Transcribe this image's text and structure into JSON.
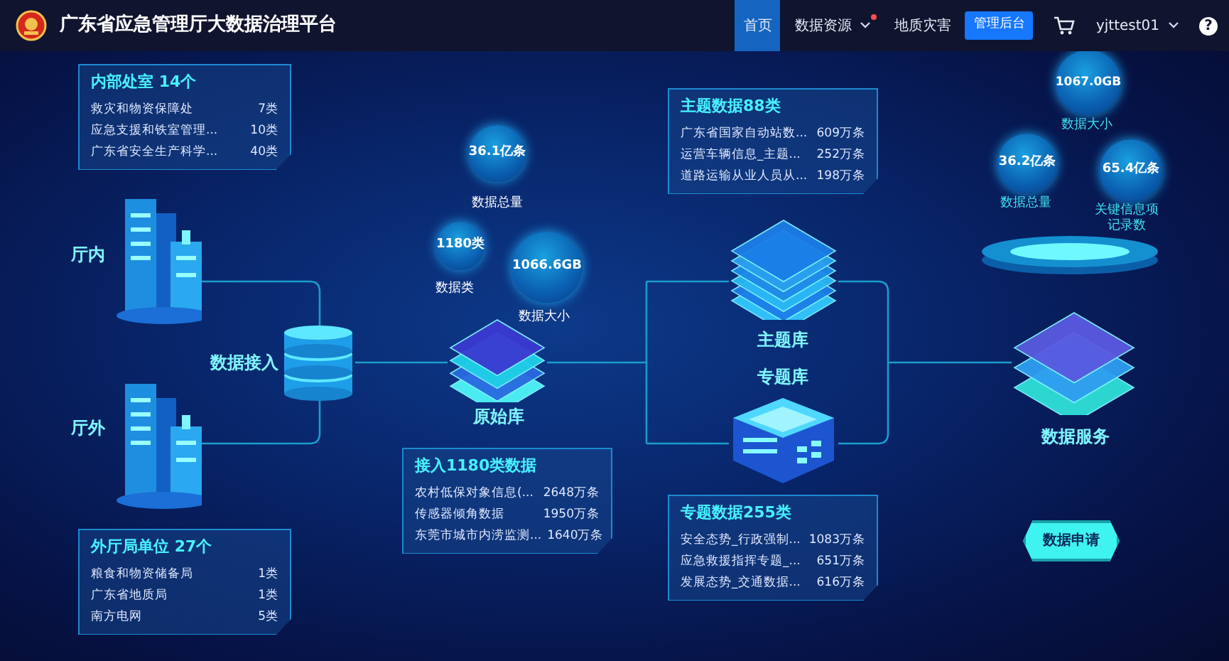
{
  "header": {
    "title": "广东省应急管理厅大数据治理平台",
    "nav": [
      {
        "label": "首页",
        "selected": true,
        "dot": false,
        "caret": false
      },
      {
        "label": "数据资源",
        "selected": false,
        "dot": true,
        "caret": true
      },
      {
        "label": "地质灾害",
        "selected": false,
        "dot": false,
        "caret": false
      }
    ],
    "admin_button": "管理后台",
    "user": "yjttest01",
    "help": "?"
  },
  "panels": [
    {
      "title": "内部处室 14个",
      "rows": [
        {
          "name": "救灾和物资保障处",
          "value": "7类"
        },
        {
          "name": "应急支援和铁室管理...",
          "value": "10类"
        },
        {
          "name": "广东省安全生产科学...",
          "value": "40类"
        }
      ]
    },
    {
      "title": "外厅局单位 27个",
      "rows": [
        {
          "name": "粮食和物资储备局",
          "value": "1类"
        },
        {
          "name": "广东省地质局",
          "value": "1类"
        },
        {
          "name": "南方电网",
          "value": "5类"
        }
      ]
    },
    {
      "title": "接入1180类数据",
      "rows": [
        {
          "name": "农村低保对象信息(...",
          "value": "2648万条"
        },
        {
          "name": "传感器倾角数据",
          "value": "1950万条"
        },
        {
          "name": "东莞市城市内涝监测...",
          "value": "1640万条"
        }
      ]
    },
    {
      "title": "主题数据88类",
      "rows": [
        {
          "name": "广东省国家自动站数...",
          "value": "609万条"
        },
        {
          "name": "运营车辆信息_主题...",
          "value": "252万条"
        },
        {
          "name": "道路运输从业人员从...",
          "value": "198万条"
        }
      ]
    },
    {
      "title": "专题数据255类",
      "rows": [
        {
          "name": "安全态势_行政强制...",
          "value": "1083万条"
        },
        {
          "name": "应急救援指挥专题_...",
          "value": "651万条"
        },
        {
          "name": "发展态势_交通数据...",
          "value": "616万条"
        }
      ]
    }
  ],
  "nodes": [
    {
      "kind": "building",
      "label": "厅内"
    },
    {
      "kind": "building",
      "label": "厅外"
    },
    {
      "kind": "database",
      "label": "数据接入"
    },
    {
      "kind": "raw",
      "label": "原始库"
    },
    {
      "kind": "topic",
      "label": "主题库"
    },
    {
      "kind": "special",
      "label": "专题库"
    },
    {
      "kind": "service",
      "label": "数据服务"
    }
  ],
  "raw_stats": [
    {
      "value": "36.1亿条",
      "caption": "数据总量"
    },
    {
      "value": "1180类",
      "caption": "数据类"
    },
    {
      "value": "1066.6GB",
      "caption": "数据大小"
    }
  ],
  "service_stats": [
    {
      "value": "1067.0GB",
      "caption": "数据大小"
    },
    {
      "value": "36.2亿条",
      "caption": "数据总量"
    },
    {
      "value": "65.4亿条",
      "caption": "关键信息项记录数"
    }
  ],
  "apply_button": "数据申请"
}
